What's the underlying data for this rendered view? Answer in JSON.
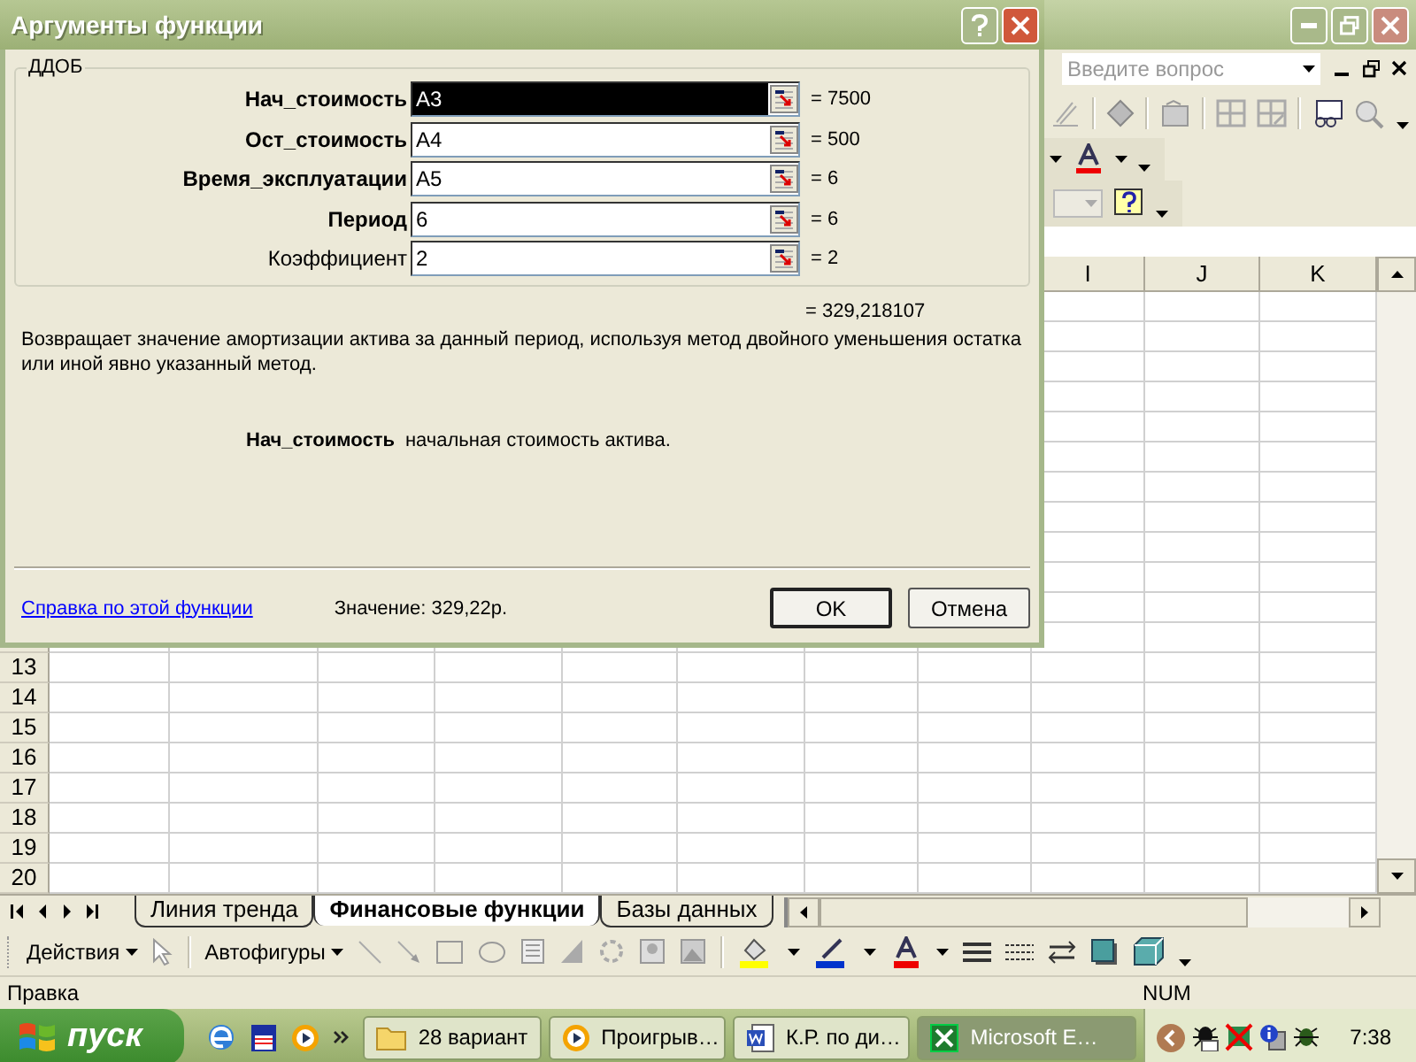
{
  "menu_bar": {
    "question_field": {
      "placeholder": "Введите вопрос"
    }
  },
  "spreadsheet": {
    "columns": [
      "I",
      "J",
      "K"
    ],
    "rows": [
      "13",
      "14",
      "15",
      "16",
      "17",
      "18",
      "19",
      "20"
    ]
  },
  "sheet_tabs": [
    {
      "label": "Линия тренда",
      "selected": false
    },
    {
      "label": "Финансовые функции",
      "selected": true
    },
    {
      "label": "Базы данных",
      "selected": false
    }
  ],
  "drawing_toolbar": {
    "actions_menu": "Действия",
    "autoshapes_menu": "Автофигуры"
  },
  "status_bar": {
    "mode": "Правка",
    "indicator": "NUM"
  },
  "taskbar": {
    "start": "пуск",
    "tasks": [
      {
        "label": "28 вариант",
        "kind": "folder",
        "selected": false
      },
      {
        "label": "Проигрыв…",
        "kind": "player",
        "selected": false
      },
      {
        "label": "К.Р. по ди…",
        "kind": "word",
        "selected": false
      },
      {
        "label": "Microsoft E…",
        "kind": "excel",
        "selected": true
      }
    ],
    "clock": "7:38"
  },
  "dialog": {
    "title": "Аргументы функции",
    "function_name": "ДДОБ",
    "arguments": [
      {
        "label": "Нач_стоимость",
        "value": "A3",
        "result": "= 7500",
        "required": true,
        "selected": true
      },
      {
        "label": "Ост_стоимость",
        "value": "A4",
        "result": "= 500",
        "required": true,
        "selected": false
      },
      {
        "label": "Время_эксплуатации",
        "value": "A5",
        "result": "= 6",
        "required": true,
        "selected": false
      },
      {
        "label": "Период",
        "value": "6",
        "result": "= 6",
        "required": true,
        "selected": false
      },
      {
        "label": "Коэффициент",
        "value": "2",
        "result": "= 2",
        "required": false,
        "selected": false
      }
    ],
    "result": "= 329,218107",
    "description": "Возвращает значение амортизации актива за данный период, используя метод двойного уменьшения остатка или иной явно указанный метод.",
    "argument_help": {
      "name": "Нач_стоимость",
      "text": "начальная стоимость актива."
    },
    "help_link": "Справка по этой функции",
    "value_label": "Значение:",
    "value": "329,22р.",
    "buttons": [
      "OK",
      "Отмена"
    ]
  }
}
